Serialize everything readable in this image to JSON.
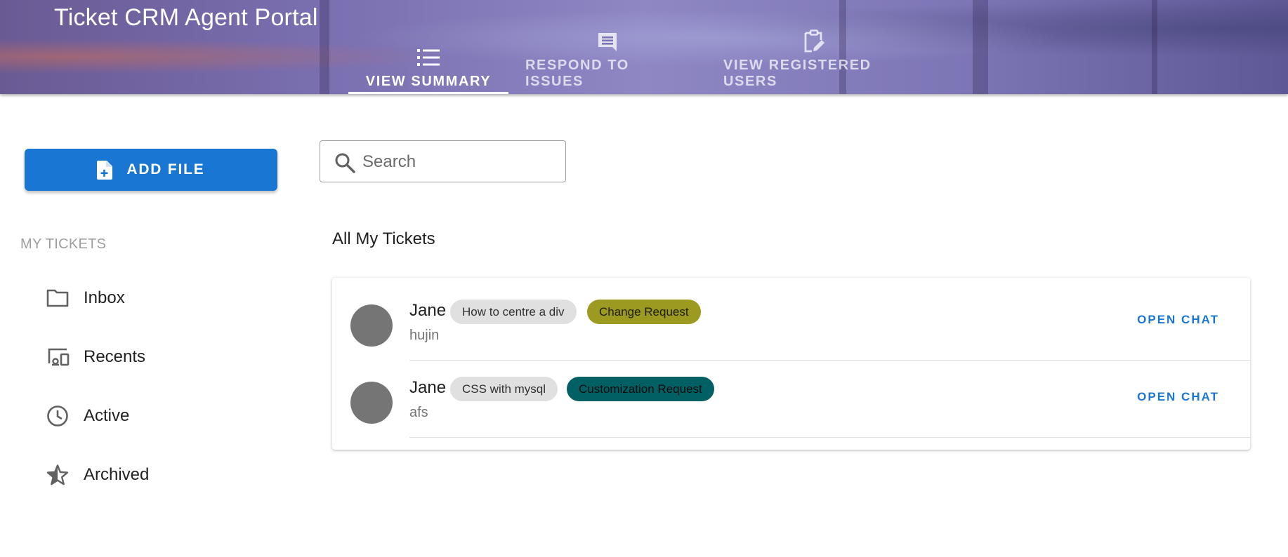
{
  "header": {
    "title": "Ticket CRM Agent Portal",
    "tabs": [
      {
        "label": "VIEW SUMMARY",
        "icon": "list-icon",
        "active": true
      },
      {
        "label": "RESPOND TO ISSUES",
        "icon": "message-icon",
        "active": false
      },
      {
        "label": "VIEW REGISTERED USERS",
        "icon": "clipboard-edit-icon",
        "active": false
      }
    ]
  },
  "sidebar": {
    "add_file_label": "ADD FILE",
    "section_label": "MY TICKETS",
    "items": [
      {
        "label": "Inbox",
        "icon": "folder-icon"
      },
      {
        "label": "Recents",
        "icon": "devices-icon"
      },
      {
        "label": "Active",
        "icon": "clock-icon"
      },
      {
        "label": "Archived",
        "icon": "star-icon"
      }
    ]
  },
  "search": {
    "placeholder": "Search",
    "value": ""
  },
  "main": {
    "list_title": "All My Tickets",
    "tickets": [
      {
        "name": "Jane",
        "subject": "How to centre a div",
        "type": "Change Request",
        "subtitle": "hujin",
        "action": "OPEN CHAT"
      },
      {
        "name": "Jane",
        "subject": "CSS with mysql",
        "type": "Customization Request",
        "subtitle": "afs",
        "action": "OPEN CHAT"
      }
    ]
  },
  "colors": {
    "primary": "#1976d2",
    "chip_change_request": "#9c9a20",
    "chip_customization_request": "#006064",
    "chip_subject": "#e0e0e0",
    "avatar": "#757575"
  }
}
